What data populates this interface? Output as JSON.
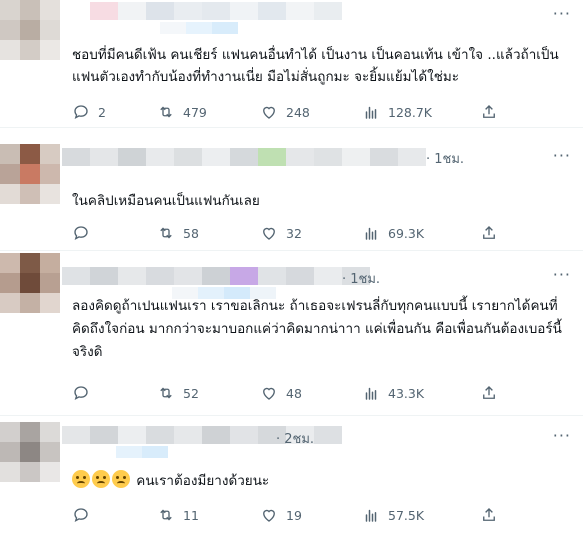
{
  "replies": [
    {
      "time": "",
      "text": "ชอบที่มีคนดีเฟ้น คนเชียร์ แฟนคนอื่นทำได้ เป็นงาน เป็นคอนเท้น เข้าใจ ..แล้วถ้าเป็นแฟนตัวเองทำกับน้องที่ทำงานเนี่ย มือไม่สั่นถูกมะ จะยิ้มแย้มได้ใช่มะ",
      "has_emoji": false,
      "replies_count": "2",
      "reposts_count": "479",
      "likes_count": "248",
      "views_count": "128.7K",
      "avatar_colors": [
        "#d9d4cf",
        "#c9c0b8",
        "#e4e0dc",
        "#cfc8c2",
        "#b9ada3",
        "#dedad6",
        "#e6e3e0",
        "#d3ccc6",
        "#ebe8e5"
      ],
      "name_colors": [
        "#ffffff",
        "#f7dce3",
        "#f1f3f5",
        "#dde3ea",
        "#e9edf1",
        "#e4e9ee",
        "#f0f3f6",
        "#e2e8ee",
        "#f2f4f6",
        "#e9edf0"
      ],
      "sub_colors": [
        "#f4f7fa",
        "#e6f3fd",
        "#d8ecfb"
      ]
    },
    {
      "time": "· 1ชม.",
      "text": "ในคลิปเหมือนคนเป็นแฟนกันเลย",
      "has_emoji": false,
      "replies_count": "",
      "reposts_count": "58",
      "likes_count": "32",
      "views_count": "69.3K",
      "avatar_colors": [
        "#c9bdb4",
        "#8c5a45",
        "#d7cbc2",
        "#b9a398",
        "#c97a63",
        "#cdb8ad",
        "#e2dbd6",
        "#cfbfb6",
        "#e8e3df"
      ],
      "name_colors": [
        "#d7dadd",
        "#e4e6e8",
        "#cfd3d6",
        "#e8eaec",
        "#dcdfe1",
        "#eceef0",
        "#d5d9dc",
        "#bfe0b2",
        "#e5e7e9",
        "#dfe2e4",
        "#eef0f1",
        "#d9dcdf",
        "#e7e9eb"
      ],
      "sub_colors": []
    },
    {
      "time": "· 1ชม.",
      "text": "ลองคิดดูถ้าเปนแฟนเรา เราขอเลิกนะ ถ้าเธอจะเฟรนลี่กับทุกคนแบบนี้ เรายากได้คนที่คิดถึงใจก่อน มากกว่าจะมาบอกแค่ว่าคิดมากน่าาา แค่เพื่อนกัน คือเพื่อนกันต้องเบอร์นี้จริงดิ",
      "has_emoji": false,
      "replies_count": "",
      "reposts_count": "52",
      "likes_count": "48",
      "views_count": "43.3K",
      "avatar_colors": [
        "#cdb9ad",
        "#7e5a47",
        "#c5ae9f",
        "#b59c8e",
        "#6f4b3a",
        "#b8a092",
        "#d8cbc3",
        "#c4b1a5",
        "#e1d6cf"
      ],
      "name_colors": [
        "#dfe2e5",
        "#d0d4d8",
        "#e6e8ea",
        "#d8dbdf",
        "#e2e4e7",
        "#cdd1d5",
        "#c7a8e6",
        "#e0e3e6",
        "#d6d9dd",
        "#eaecee",
        "#dcdfe2"
      ],
      "sub_colors": [
        "#f3f6f9",
        "#e3f1fc",
        "#d4eafb",
        "#eef4f9"
      ]
    },
    {
      "time": "· 2ชม.",
      "text": "คนเราต้องมียางด้วยนะ",
      "has_emoji": true,
      "replies_count": "",
      "reposts_count": "11",
      "likes_count": "19",
      "views_count": "57.5K",
      "avatar_colors": [
        "#d2cfcd",
        "#a9a4a1",
        "#dcdad8",
        "#bdb8b5",
        "#8d8784",
        "#c8c4c1",
        "#e2e0de",
        "#cbc7c5",
        "#e9e7e6"
      ],
      "name_colors": [
        "#e4e6e8",
        "#d2d5d8",
        "#eceef0",
        "#d9dcdf",
        "#e6e8ea",
        "#cfd2d5",
        "#e1e3e6",
        "#d6d9dc",
        "#eaecee",
        "#dde0e3"
      ],
      "sub_colors": [
        "#e5f2fc",
        "#d8ecfb"
      ]
    }
  ]
}
